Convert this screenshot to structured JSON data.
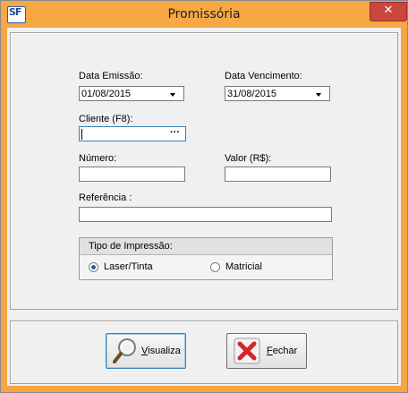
{
  "window": {
    "title": "Promissória",
    "close_glyph": "✕",
    "app_icon": "SF"
  },
  "form": {
    "data_emissao": {
      "label": "Data Emissão:",
      "value": "01/08/2015"
    },
    "data_vencimento": {
      "label": "Data Vencimento:",
      "value": "31/08/2015"
    },
    "cliente": {
      "label": "Cliente (F8):",
      "value": "",
      "button_label": "···"
    },
    "numero": {
      "label": "Número:",
      "value": ""
    },
    "valor": {
      "label": "Valor (R$):",
      "value": ""
    },
    "referencia": {
      "label": "Referência :",
      "value": ""
    },
    "tipo_impressao": {
      "label": "Tipo de Impressão:",
      "options": [
        {
          "label": "Laser/Tinta",
          "selected": true
        },
        {
          "label": "Matricial",
          "selected": false
        }
      ]
    }
  },
  "buttons": {
    "visualiza": {
      "label_first": "V",
      "label_rest": "isualiza"
    },
    "fechar": {
      "label_first": "F",
      "label_rest": "echar"
    }
  },
  "colors": {
    "titlebar": "#f5a844",
    "close_button": "#c9463d",
    "radio_dot": "#2c5fa0"
  }
}
